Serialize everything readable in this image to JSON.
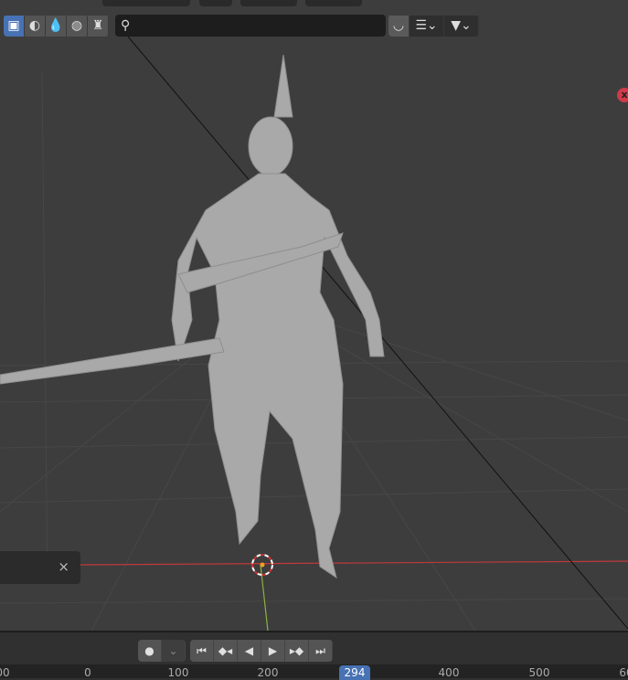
{
  "viewport": {
    "search": {
      "placeholder": ""
    },
    "shading_modes": [
      "solid",
      "material-preview",
      "rendered",
      "world"
    ],
    "close_label": "×",
    "badge_label": "x"
  },
  "timeline": {
    "current_frame": "294",
    "ticks": [
      "00",
      "0",
      "100",
      "200",
      "400",
      "500",
      "60"
    ]
  },
  "colors": {
    "accent": "#4772b3",
    "x_axis": "#c0393b",
    "y_axis": "#8ab33d"
  }
}
